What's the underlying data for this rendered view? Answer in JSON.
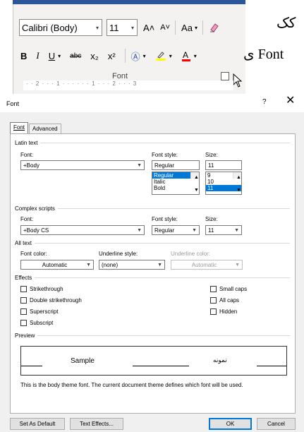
{
  "ribbon": {
    "font_name": "Calibri (Body)",
    "font_size": "11",
    "grow_font": "A˄",
    "shrink_font": "A˅",
    "change_case": "Aa",
    "bold": "B",
    "italic": "I",
    "underline": "U",
    "strikethrough": "abc",
    "subscript": "x₂",
    "superscript": "x²",
    "group_label": "Font",
    "ruler_text": "· · 2 · · · 1 · · · · · · 1 · · · 2 · · · 3",
    "doc_text_1": "کک",
    "doc_text_2": "ی Font"
  },
  "dialog": {
    "title": "Font",
    "help": "?",
    "close": "✕",
    "tabs": [
      "Font",
      "Advanced"
    ],
    "latin": {
      "section": "Latin text",
      "font_label": "Font:",
      "font_value": "+Body",
      "style_label": "Font style:",
      "style_value": "Regular",
      "style_list": [
        "Regular",
        "Italic",
        "Bold"
      ],
      "size_label": "Size:",
      "size_value": "11",
      "size_list": [
        "9",
        "10",
        "11"
      ]
    },
    "complex": {
      "section": "Complex scripts",
      "font_label": "Font:",
      "font_value": "+Body CS",
      "style_label": "Font style:",
      "style_value": "Regular",
      "size_label": "Size:",
      "size_value": "11"
    },
    "all_text": {
      "section": "All text",
      "color_label": "Font color:",
      "color_value": "Automatic",
      "underline_label": "Underline style:",
      "underline_value": "(none)",
      "ucolor_label": "Underline color:",
      "ucolor_value": "Automatic"
    },
    "effects": {
      "section": "Effects",
      "left": [
        "Strikethrough",
        "Double strikethrough",
        "Superscript",
        "Subscript"
      ],
      "right": [
        "Small caps",
        "All caps",
        "Hidden"
      ]
    },
    "preview": {
      "section": "Preview",
      "sample_latin": "Sample",
      "sample_arabic": "نمونه",
      "description": "This is the body theme font. The current document theme defines which font will be used."
    },
    "buttons": {
      "set_default": "Set As Default",
      "text_effects": "Text Effects...",
      "ok": "OK",
      "cancel": "Cancel"
    }
  },
  "colors": {
    "ribbon_blue": "#2b579a",
    "selection": "#0078d7",
    "highlight_yellow": "#ffff00",
    "font_color_red": "#ff0000"
  }
}
